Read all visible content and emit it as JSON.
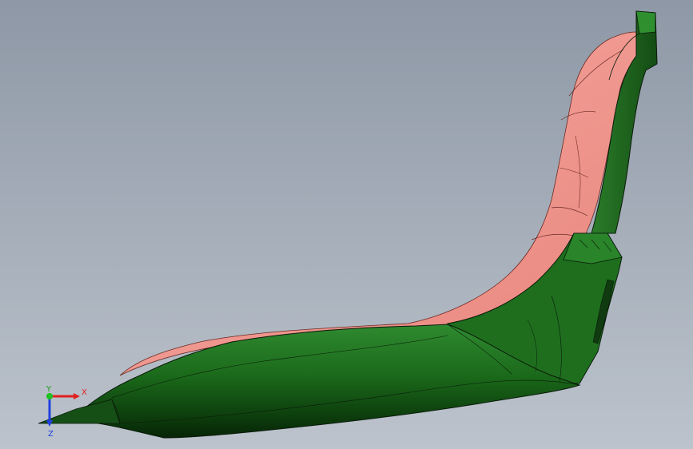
{
  "viewport": {
    "background_top": "#8e98a6",
    "background_bottom": "#b9c0ca",
    "part_color": "#1f6b1f",
    "part_dark": "#0b2f0b",
    "face_color": "#f29a92",
    "edge_color": "#0a1a0a"
  },
  "triad": {
    "x_label": "X",
    "y_label": "Y",
    "z_label": "Z",
    "x_color": "#e02020",
    "y_color": "#20c020",
    "z_color": "#2040e0"
  }
}
